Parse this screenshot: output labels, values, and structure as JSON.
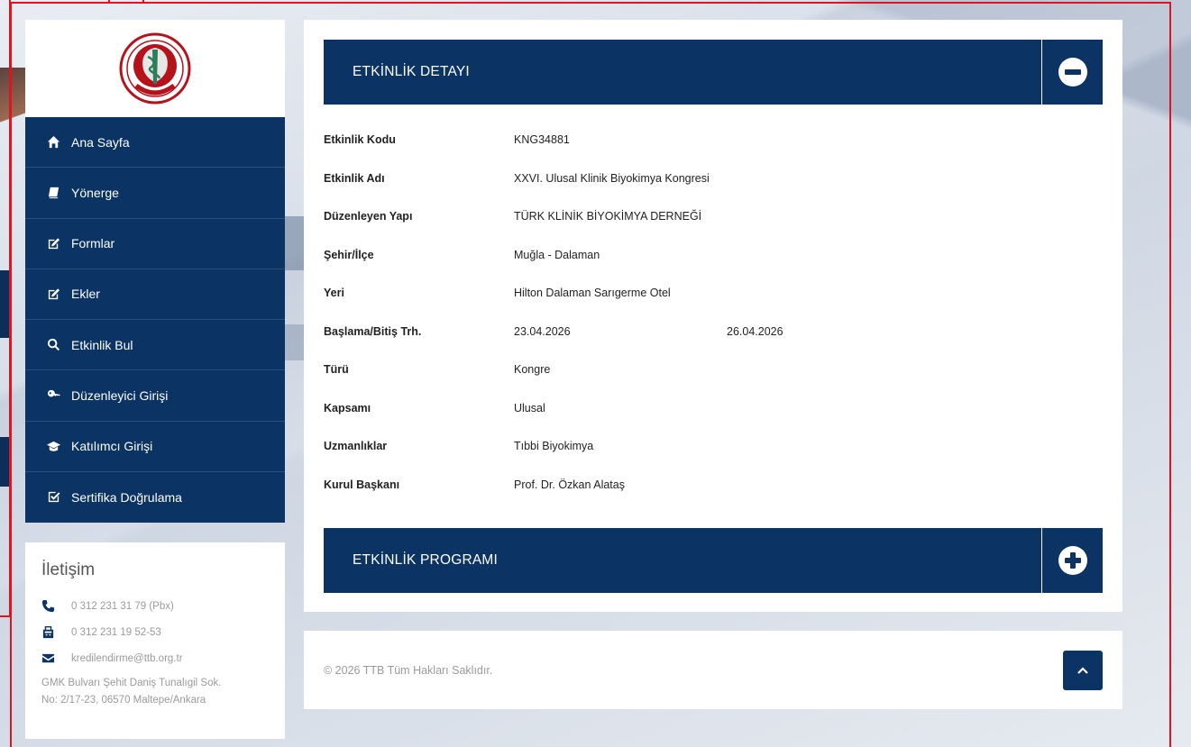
{
  "sidebar": {
    "items": [
      {
        "label": "Ana Sayfa",
        "icon": "home-icon"
      },
      {
        "label": "Yönerge",
        "icon": "book-icon"
      },
      {
        "label": "Formlar",
        "icon": "edit-icon"
      },
      {
        "label": "Ekler",
        "icon": "edit-icon"
      },
      {
        "label": "Etkinlik Bul",
        "icon": "search-icon"
      },
      {
        "label": "Düzenleyici Girişi",
        "icon": "key-icon"
      },
      {
        "label": "Katılımcı Girişi",
        "icon": "graduation-cap-icon"
      },
      {
        "label": "Sertifika Doğrulama",
        "icon": "check-square-icon"
      }
    ]
  },
  "contact": {
    "title": "İletişim",
    "phone": "0 312 231 31 79 (Pbx)",
    "fax": "0 312 231 19 52-53",
    "email": "kredilendirme@ttb.org.tr",
    "address_line1": "GMK Bulvarı Şehit Daniş Tunalıgil Sok.",
    "address_line2": "No: 2/17-23, 06570 Maltepe/Ankara"
  },
  "event_detail": {
    "title": "ETKİNLİK DETAYI",
    "rows": [
      {
        "label": "Etkinlik Kodu",
        "value": "KNG34881",
        "value2": ""
      },
      {
        "label": "Etkinlik Adı",
        "value": "XXVI. Ulusal Klinik Biyokimya Kongresi",
        "value2": ""
      },
      {
        "label": "Düzenleyen Yapı",
        "value": "TÜRK KLİNİK BİYOKİMYA DERNEĞİ",
        "value2": ""
      },
      {
        "label": "Şehir/İlçe",
        "value": "Muğla - Dalaman",
        "value2": ""
      },
      {
        "label": "Yeri",
        "value": "Hilton Dalaman Sarıgerme Otel",
        "value2": ""
      },
      {
        "label": "Başlama/Bitiş Trh.",
        "value": "23.04.2026",
        "value2": "26.04.2026"
      },
      {
        "label": "Türü",
        "value": "Kongre",
        "value2": ""
      },
      {
        "label": "Kapsamı",
        "value": "Ulusal",
        "value2": ""
      },
      {
        "label": "Uzmanlıklar",
        "value": "Tıbbi Biyokimya",
        "value2": ""
      },
      {
        "label": "Kurul Başkanı",
        "value": "Prof. Dr. Özkan Alataş",
        "value2": ""
      }
    ]
  },
  "event_program": {
    "title": "ETKİNLİK PROGRAMI"
  },
  "footer": {
    "copyright": "© 2026 TTB Tüm Hakları Saklıdır."
  },
  "colors": {
    "primary": "#0b3363",
    "frame": "#e0141e",
    "logo_red": "#b5121b"
  }
}
